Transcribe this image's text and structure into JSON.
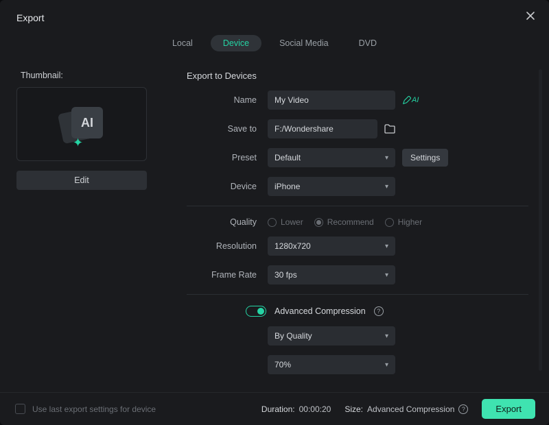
{
  "window": {
    "title": "Export"
  },
  "tabs": {
    "local": "Local",
    "device": "Device",
    "social": "Social Media",
    "dvd": "DVD",
    "active": "device"
  },
  "thumbnail": {
    "label": "Thumbnail:",
    "ai_badge": "AI",
    "edit": "Edit"
  },
  "section_title": "Export to Devices",
  "labels": {
    "name": "Name",
    "save_to": "Save to",
    "preset": "Preset",
    "device": "Device",
    "quality": "Quality",
    "resolution": "Resolution",
    "frame_rate": "Frame Rate",
    "adv_compression": "Advanced Compression"
  },
  "fields": {
    "name": "My Video",
    "save_to": "F:/Wondershare",
    "preset": "Default",
    "device": "iPhone",
    "resolution": "1280x720",
    "frame_rate": "30 fps",
    "compression_mode": "By Quality",
    "compression_value": "70%"
  },
  "buttons": {
    "settings": "Settings",
    "export": "Export",
    "ai_suffix": "AI"
  },
  "quality_options": {
    "lower": "Lower",
    "recommend": "Recommend",
    "higher": "Higher",
    "selected": "recommend"
  },
  "footer": {
    "use_last": "Use last export settings for device",
    "duration_label": "Duration:",
    "duration_value": "00:00:20",
    "size_label": "Size:",
    "size_value": "Advanced Compression"
  }
}
